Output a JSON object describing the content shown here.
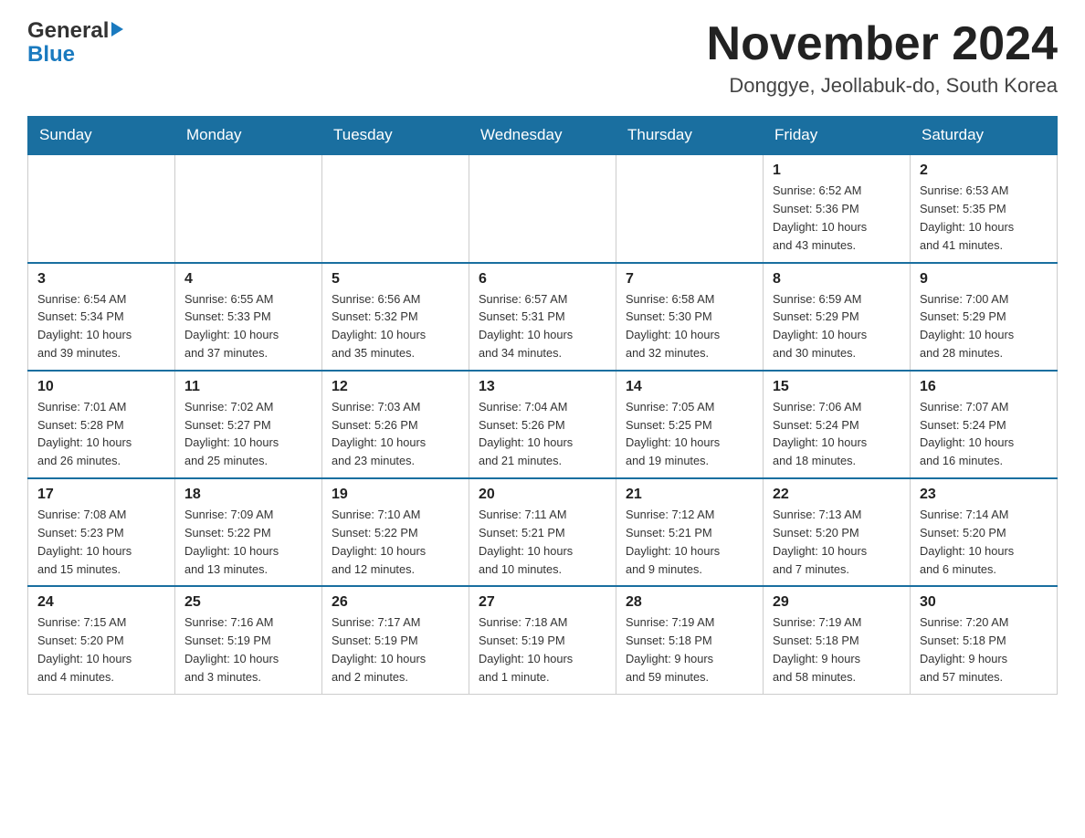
{
  "header": {
    "logo_general": "General",
    "logo_blue": "Blue",
    "month_title": "November 2024",
    "location": "Donggye, Jeollabuk-do, South Korea"
  },
  "weekdays": [
    "Sunday",
    "Monday",
    "Tuesday",
    "Wednesday",
    "Thursday",
    "Friday",
    "Saturday"
  ],
  "weeks": [
    {
      "days": [
        {
          "date": "",
          "info": ""
        },
        {
          "date": "",
          "info": ""
        },
        {
          "date": "",
          "info": ""
        },
        {
          "date": "",
          "info": ""
        },
        {
          "date": "",
          "info": ""
        },
        {
          "date": "1",
          "info": "Sunrise: 6:52 AM\nSunset: 5:36 PM\nDaylight: 10 hours\nand 43 minutes."
        },
        {
          "date": "2",
          "info": "Sunrise: 6:53 AM\nSunset: 5:35 PM\nDaylight: 10 hours\nand 41 minutes."
        }
      ]
    },
    {
      "days": [
        {
          "date": "3",
          "info": "Sunrise: 6:54 AM\nSunset: 5:34 PM\nDaylight: 10 hours\nand 39 minutes."
        },
        {
          "date": "4",
          "info": "Sunrise: 6:55 AM\nSunset: 5:33 PM\nDaylight: 10 hours\nand 37 minutes."
        },
        {
          "date": "5",
          "info": "Sunrise: 6:56 AM\nSunset: 5:32 PM\nDaylight: 10 hours\nand 35 minutes."
        },
        {
          "date": "6",
          "info": "Sunrise: 6:57 AM\nSunset: 5:31 PM\nDaylight: 10 hours\nand 34 minutes."
        },
        {
          "date": "7",
          "info": "Sunrise: 6:58 AM\nSunset: 5:30 PM\nDaylight: 10 hours\nand 32 minutes."
        },
        {
          "date": "8",
          "info": "Sunrise: 6:59 AM\nSunset: 5:29 PM\nDaylight: 10 hours\nand 30 minutes."
        },
        {
          "date": "9",
          "info": "Sunrise: 7:00 AM\nSunset: 5:29 PM\nDaylight: 10 hours\nand 28 minutes."
        }
      ]
    },
    {
      "days": [
        {
          "date": "10",
          "info": "Sunrise: 7:01 AM\nSunset: 5:28 PM\nDaylight: 10 hours\nand 26 minutes."
        },
        {
          "date": "11",
          "info": "Sunrise: 7:02 AM\nSunset: 5:27 PM\nDaylight: 10 hours\nand 25 minutes."
        },
        {
          "date": "12",
          "info": "Sunrise: 7:03 AM\nSunset: 5:26 PM\nDaylight: 10 hours\nand 23 minutes."
        },
        {
          "date": "13",
          "info": "Sunrise: 7:04 AM\nSunset: 5:26 PM\nDaylight: 10 hours\nand 21 minutes."
        },
        {
          "date": "14",
          "info": "Sunrise: 7:05 AM\nSunset: 5:25 PM\nDaylight: 10 hours\nand 19 minutes."
        },
        {
          "date": "15",
          "info": "Sunrise: 7:06 AM\nSunset: 5:24 PM\nDaylight: 10 hours\nand 18 minutes."
        },
        {
          "date": "16",
          "info": "Sunrise: 7:07 AM\nSunset: 5:24 PM\nDaylight: 10 hours\nand 16 minutes."
        }
      ]
    },
    {
      "days": [
        {
          "date": "17",
          "info": "Sunrise: 7:08 AM\nSunset: 5:23 PM\nDaylight: 10 hours\nand 15 minutes."
        },
        {
          "date": "18",
          "info": "Sunrise: 7:09 AM\nSunset: 5:22 PM\nDaylight: 10 hours\nand 13 minutes."
        },
        {
          "date": "19",
          "info": "Sunrise: 7:10 AM\nSunset: 5:22 PM\nDaylight: 10 hours\nand 12 minutes."
        },
        {
          "date": "20",
          "info": "Sunrise: 7:11 AM\nSunset: 5:21 PM\nDaylight: 10 hours\nand 10 minutes."
        },
        {
          "date": "21",
          "info": "Sunrise: 7:12 AM\nSunset: 5:21 PM\nDaylight: 10 hours\nand 9 minutes."
        },
        {
          "date": "22",
          "info": "Sunrise: 7:13 AM\nSunset: 5:20 PM\nDaylight: 10 hours\nand 7 minutes."
        },
        {
          "date": "23",
          "info": "Sunrise: 7:14 AM\nSunset: 5:20 PM\nDaylight: 10 hours\nand 6 minutes."
        }
      ]
    },
    {
      "days": [
        {
          "date": "24",
          "info": "Sunrise: 7:15 AM\nSunset: 5:20 PM\nDaylight: 10 hours\nand 4 minutes."
        },
        {
          "date": "25",
          "info": "Sunrise: 7:16 AM\nSunset: 5:19 PM\nDaylight: 10 hours\nand 3 minutes."
        },
        {
          "date": "26",
          "info": "Sunrise: 7:17 AM\nSunset: 5:19 PM\nDaylight: 10 hours\nand 2 minutes."
        },
        {
          "date": "27",
          "info": "Sunrise: 7:18 AM\nSunset: 5:19 PM\nDaylight: 10 hours\nand 1 minute."
        },
        {
          "date": "28",
          "info": "Sunrise: 7:19 AM\nSunset: 5:18 PM\nDaylight: 9 hours\nand 59 minutes."
        },
        {
          "date": "29",
          "info": "Sunrise: 7:19 AM\nSunset: 5:18 PM\nDaylight: 9 hours\nand 58 minutes."
        },
        {
          "date": "30",
          "info": "Sunrise: 7:20 AM\nSunset: 5:18 PM\nDaylight: 9 hours\nand 57 minutes."
        }
      ]
    }
  ]
}
